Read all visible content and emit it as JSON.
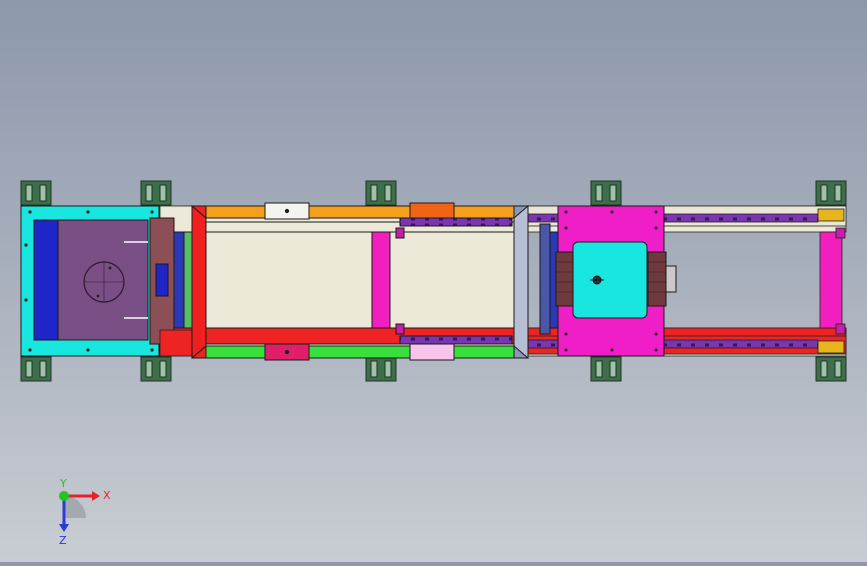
{
  "viewport": {
    "background_top": "#8d98ac",
    "background_bottom": "#c9cdd3"
  },
  "triad": {
    "x_label": "X",
    "y_label": "Y",
    "z_label": "Z",
    "x_color": "#e8202a",
    "y_color": "#22c322",
    "z_color": "#2a3bd6"
  },
  "palette": {
    "cyan": "#19e8e0",
    "magenta": "#f01ec8",
    "purple_plate": "#7b4f86",
    "blue_block": "#1f25c8",
    "red_rail": "#f02020",
    "orange_rail": "#f5a020",
    "green_rail": "#35e03c",
    "pink_post": "#f21fbf",
    "dark_green_foot": "#3d6b48",
    "violet_rail": "#6b2aa8",
    "light_rail": "#e6e6dc"
  }
}
